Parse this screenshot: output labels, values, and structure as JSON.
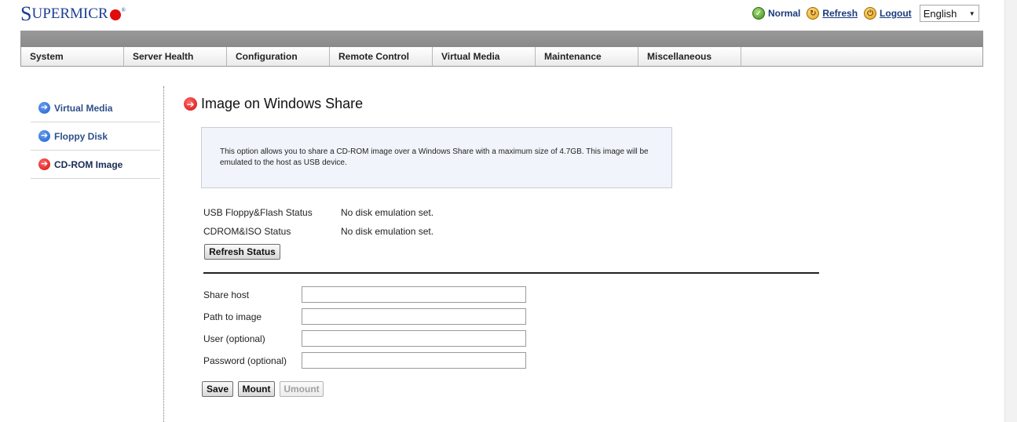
{
  "header": {
    "logo": {
      "first_letter": "S",
      "rest": "UPERMICR",
      "registered": "®"
    },
    "status_text": "Normal",
    "refresh_label": "Refresh",
    "logout_label": "Logout",
    "language": {
      "selected": "English"
    }
  },
  "menu": {
    "items": [
      {
        "label": "System"
      },
      {
        "label": "Server Health"
      },
      {
        "label": "Configuration"
      },
      {
        "label": "Remote Control"
      },
      {
        "label": "Virtual Media"
      },
      {
        "label": "Maintenance"
      },
      {
        "label": "Miscellaneous"
      }
    ]
  },
  "sidebar": {
    "items": [
      {
        "label": "Virtual Media",
        "icon": "arrow-right-blue-icon"
      },
      {
        "label": "Floppy Disk",
        "icon": "arrow-right-blue-icon"
      },
      {
        "label": "CD-ROM Image",
        "icon": "arrow-right-red-icon",
        "active": true
      }
    ]
  },
  "main": {
    "title": "Image on Windows Share",
    "info_text": "This option allows you to share a CD-ROM image over a Windows Share with a maximum size of 4.7GB. This image will be emulated to the host as USB device.",
    "status": [
      {
        "label": "USB Floppy&Flash Status",
        "value": "No disk emulation set."
      },
      {
        "label": "CDROM&ISO Status",
        "value": "No disk emulation set."
      }
    ],
    "refresh_status_label": "Refresh Status",
    "form": {
      "share_host": {
        "label": "Share host",
        "value": ""
      },
      "path_to_image": {
        "label": "Path to image",
        "value": ""
      },
      "user": {
        "label": "User (optional)",
        "value": ""
      },
      "password": {
        "label": "Password (optional)",
        "value": ""
      }
    },
    "buttons": {
      "save": "Save",
      "mount": "Mount",
      "umount": "Umount"
    }
  },
  "colors": {
    "brand_blue": "#1c3f94",
    "brand_red": "#e10b0b",
    "menu_gray": "#8a8a8a",
    "info_bg": "#f1f5fb"
  }
}
